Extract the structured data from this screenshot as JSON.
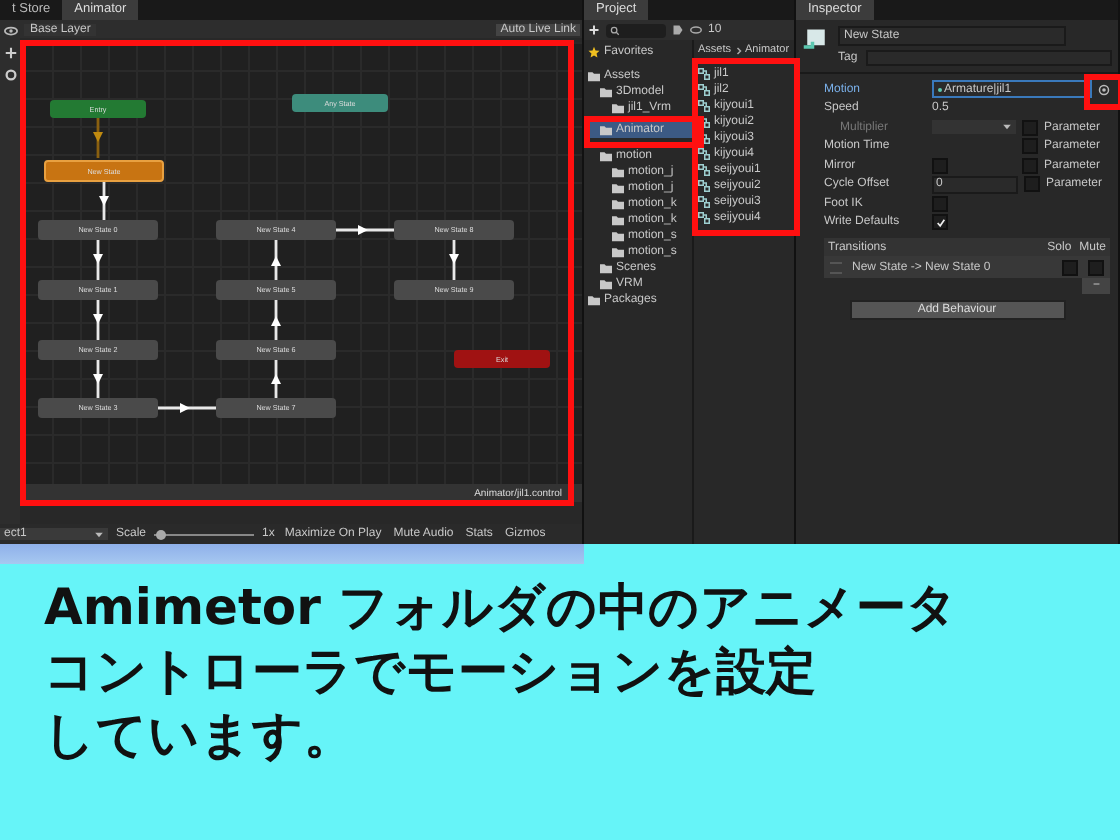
{
  "animator": {
    "tabs": [
      {
        "label": "t Store",
        "selected": false
      },
      {
        "label": "Animator",
        "selected": true
      }
    ],
    "layer": "Base Layer",
    "live_link": "Auto Live Link",
    "nodes": [
      {
        "label": "Entry",
        "kind": "entry_down"
      },
      {
        "label": "Any State",
        "kind": "any"
      },
      {
        "label": "New State",
        "kind": "default_down"
      },
      {
        "label": "New State 0",
        "kind": "state_down"
      },
      {
        "label": "New State 4",
        "kind": "state_right"
      },
      {
        "label": "New State 8",
        "kind": "state_down"
      },
      {
        "label": "New State 1",
        "kind": "state_down"
      },
      {
        "label": "New State 5",
        "kind": "state_up"
      },
      {
        "label": "New State 9",
        "kind": "state"
      },
      {
        "label": "New State 2",
        "kind": "state_down"
      },
      {
        "label": "New State 6",
        "kind": "state_up"
      },
      {
        "label": "Exit",
        "kind": "exit"
      },
      {
        "label": "New State 3",
        "kind": "state_right"
      },
      {
        "label": "New State 7",
        "kind": "state_up"
      }
    ],
    "path": "Animator/jil1.control"
  },
  "game_bar": {
    "display": "ect1",
    "scale_label": "Scale",
    "scale": "1x",
    "level": 0.05,
    "buttons": [
      "Maximize On Play",
      "Mute Audio",
      "Stats",
      "Gizmos"
    ]
  },
  "project": {
    "tab": "Project",
    "count": "10",
    "tree": [
      {
        "label": "Favorites",
        "kind": "favorites",
        "selected": false
      },
      {
        "label": "Assets",
        "kind": "folder",
        "selected": false,
        "children": [
          {
            "label": "3Dmodel",
            "kind": "folder",
            "selected": false,
            "children": [
              {
                "label": "jil1_Vrm",
                "kind": "folder",
                "selected": false
              }
            ]
          },
          {
            "label": "Animator",
            "kind": "folder",
            "selected": true
          },
          {
            "label": "motion",
            "kind": "folder",
            "selected": false,
            "children": [
              {
                "label": "motion_j",
                "kind": "folder",
                "selected": false
              },
              {
                "label": "motion_j",
                "kind": "folder",
                "selected": false
              },
              {
                "label": "motion_k",
                "kind": "folder",
                "selected": false
              },
              {
                "label": "motion_k",
                "kind": "folder",
                "selected": false
              },
              {
                "label": "motion_s",
                "kind": "folder",
                "selected": false
              },
              {
                "label": "motion_s",
                "kind": "folder",
                "selected": false
              }
            ]
          },
          {
            "label": "Scenes",
            "kind": "folder",
            "selected": false
          },
          {
            "label": "VRM",
            "kind": "folder",
            "selected": false
          }
        ]
      },
      {
        "label": "Packages",
        "kind": "folder",
        "selected": false
      }
    ],
    "breadcrumb": [
      "Assets",
      "Animator"
    ],
    "files": [
      "jil1",
      "jil2",
      "kijyoui1",
      "kijyoui2",
      "kijyoui3",
      "kijyoui4",
      "seijyoui1",
      "seijyoui2",
      "seijyoui3",
      "seijyoui4"
    ]
  },
  "inspector": {
    "tab": "Inspector",
    "name": "New State",
    "tag_label": "Tag",
    "rows": [
      {
        "label": "Motion",
        "kind": "object",
        "value": "Armature|jil1"
      },
      {
        "label": "Speed",
        "kind": "text",
        "value": "0.5"
      },
      {
        "label": "Multiplier",
        "kind": "param",
        "disabled": true,
        "param_label": "Parameter",
        "checked": false
      },
      {
        "label": "Motion Time",
        "kind": "paramonly",
        "param_label": "Parameter",
        "checked": false
      },
      {
        "label": "Mirror",
        "kind": "checkparam",
        "value_checked": false,
        "param_label": "Parameter",
        "checked": false
      },
      {
        "label": "Cycle Offset",
        "kind": "textparam",
        "value": "0",
        "param_label": "Parameter",
        "checked": false
      },
      {
        "label": "Foot IK",
        "kind": "check",
        "checked": false
      },
      {
        "label": "Write Defaults",
        "kind": "check",
        "checked": true
      }
    ],
    "transitions": {
      "title": "Transitions",
      "solo": "Solo",
      "mute": "Mute",
      "items": [
        {
          "label": "New State -> New State 0",
          "solo": false,
          "mute": false
        }
      ],
      "remove": "−"
    },
    "add_button": "Add Behaviour"
  },
  "caption": [
    "Amimetor フォルダの中のアニメータ",
    "コントローラでモーションを設定",
    "しています。"
  ]
}
